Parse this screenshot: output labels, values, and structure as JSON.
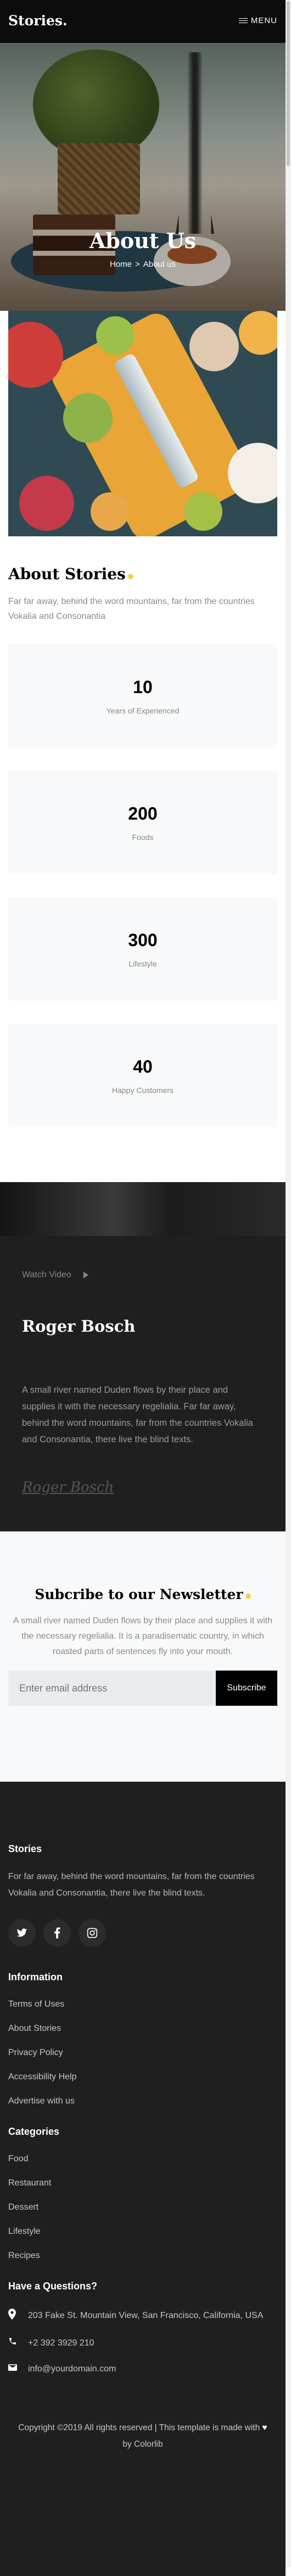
{
  "header": {
    "logo": "Stories",
    "logo_dot": ".",
    "menu_label": "MENU"
  },
  "hero": {
    "title": "About Us",
    "breadcrumb": {
      "home": "Home",
      "separator": ">",
      "current": "About us"
    }
  },
  "about": {
    "title": "About Stories",
    "description": "Far far away, behind the word mountains, far from the countries Vokalia and Consonantia"
  },
  "stats": [
    {
      "value": "10",
      "label": "Years of Experienced"
    },
    {
      "value": "200",
      "label": "Foods"
    },
    {
      "value": "300",
      "label": "Lifestyle"
    },
    {
      "value": "40",
      "label": "Happy Customers"
    }
  ],
  "video": {
    "watch_label": "Watch Video",
    "name": "Roger Bosch",
    "bio": "A small river named Duden flows by their place and supplies it with the necessary regelialia. Far far away, behind the word mountains, far from the countries Vokalia and Consonantia, there live the blind texts.",
    "signature": "Roger Bosch"
  },
  "newsletter": {
    "title": "Subcribe to our Newsletter",
    "description": "A small river named Duden flows by their place and supplies it with the necessary regelialia. It is a paradisematic country, in which roasted parts of sentences fly into your mouth.",
    "input_placeholder": "Enter email address",
    "button_label": "Subscribe"
  },
  "footer": {
    "brand": "Stories",
    "description": "For far away, behind the word mountains, far from the countries Vokalia and Consonantia, there live the blind texts.",
    "socials": [
      "twitter-icon",
      "facebook-icon",
      "instagram-icon"
    ],
    "information_title": "Information",
    "information_links": [
      "Terms of Uses",
      "About Stories",
      "Privacy Policy",
      "Accessibility Help",
      "Advertise with us"
    ],
    "categories_title": "Categories",
    "categories_links": [
      "Food",
      "Restaurant",
      "Dessert",
      "Lifestyle",
      "Recipes"
    ],
    "contact_title": "Have a Questions?",
    "address": "203 Fake St. Mountain View, San Francisco, California, USA",
    "phone": "+2 392 3929 210",
    "email": "info@yourdomain.com",
    "copyright_prefix": "Copyright ©2019 All rights reserved | This template is made with",
    "copyright_suffix": "by Colorlib"
  }
}
